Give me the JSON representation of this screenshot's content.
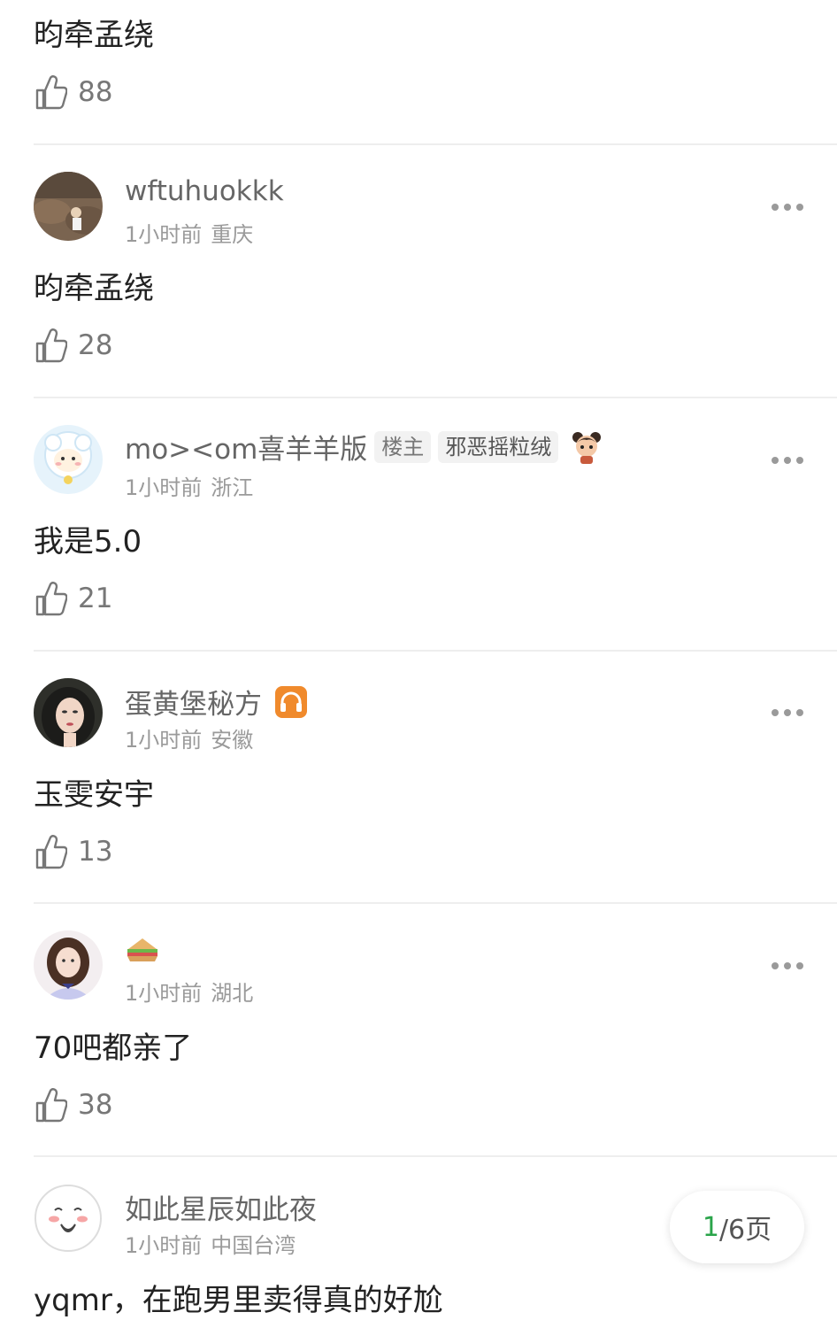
{
  "comments": [
    {
      "content": "昀牵孟绕",
      "likes": "88"
    },
    {
      "username": "wftuhuokkk",
      "time": "1小时前",
      "location": "重庆",
      "content": "昀牵孟绕",
      "likes": "28",
      "avatar_icon": "rocky-landscape-avatar"
    },
    {
      "username": "mo><om喜羊羊版",
      "host_badge": "楼主",
      "tag_badge": "邪恶摇粒绒",
      "emoji_icon": "girl-emoji-icon",
      "time": "1小时前",
      "location": "浙江",
      "content": "我是5.0",
      "likes": "21",
      "avatar_icon": "sheep-cartoon-avatar"
    },
    {
      "username": "蛋黄堡秘方",
      "badge_icon": "headphones-badge-icon",
      "badge_color": "#f08a2c",
      "time": "1小时前",
      "location": "安徽",
      "content": "玉雯安宇",
      "likes": "13",
      "avatar_icon": "woman-portrait-avatar"
    },
    {
      "username_icon": "sandwich-icon",
      "time": "1小时前",
      "location": "湖北",
      "content": "70吧都亲了",
      "likes": "38",
      "avatar_icon": "girl-photo-avatar"
    },
    {
      "username": "如此星辰如此夜",
      "time": "1小时前",
      "location": "中国台湾",
      "content": "yqmr，在跑男里卖得真的好尬",
      "avatar_icon": "blushing-cartoon-avatar"
    }
  ],
  "pager": {
    "current": "1",
    "total": "/6页",
    "current_color": "#2aa44a"
  },
  "colors": {
    "divider": "#eeeeee",
    "username": "#666666",
    "meta": "#9a9a9a"
  }
}
